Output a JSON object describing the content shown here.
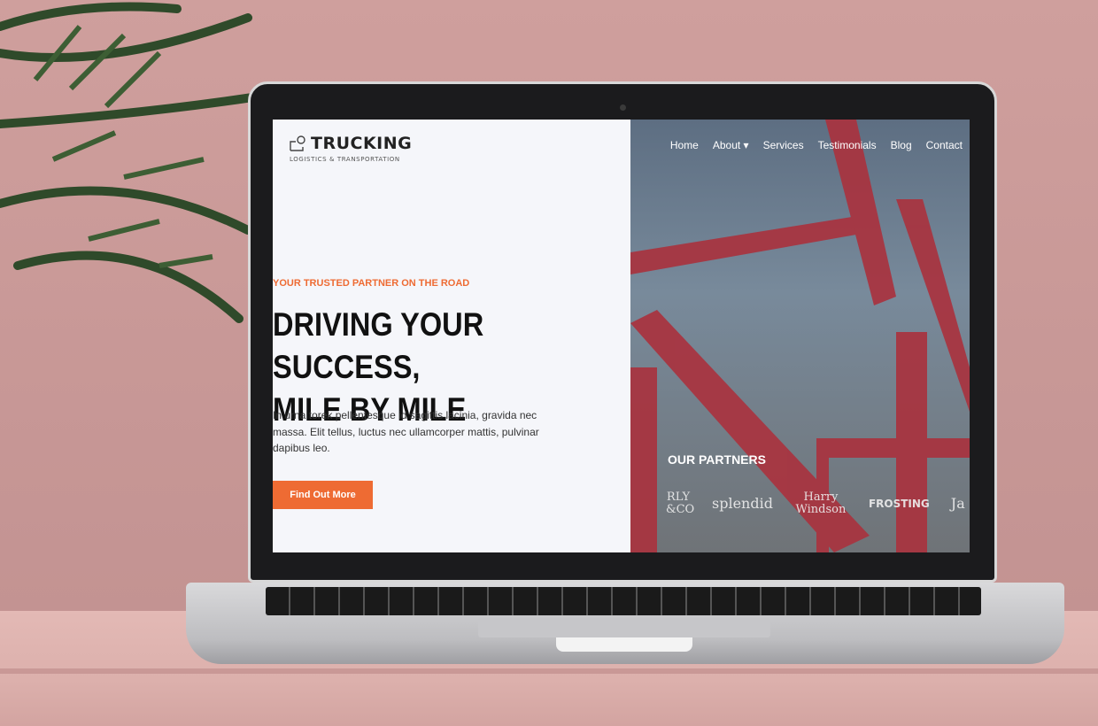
{
  "site": {
    "logo": {
      "name": "TRUCKING",
      "subtitle": "LOGISTICS & TRANSPORTATION",
      "icon": "map-pin-route-icon"
    },
    "nav": [
      {
        "label": "Home"
      },
      {
        "label": "About ▾"
      },
      {
        "label": "Services"
      },
      {
        "label": "Testimonials"
      },
      {
        "label": "Blog"
      },
      {
        "label": "Contact"
      }
    ],
    "hero": {
      "tagline": "YOUR TRUSTED PARTNER ON THE ROAD",
      "headline_line1": "DRIVING YOUR SUCCESS,",
      "headline_line2": "MILE BY MILE",
      "description": "In urna torek pellentesque id sagittis lacinia, gravida nec massa. Elit tellus, luctus nec ullamcorper mattis, pulvinar dapibus leo.",
      "cta": "Find Out More"
    },
    "partners": {
      "title": "OUR PARTNERS",
      "logos": [
        "RLY &CO",
        "splendid",
        "Harry Windson",
        "FROSTING",
        "Ja"
      ]
    },
    "colors": {
      "accent": "#ee6b33",
      "crane": "#b03a44"
    }
  }
}
